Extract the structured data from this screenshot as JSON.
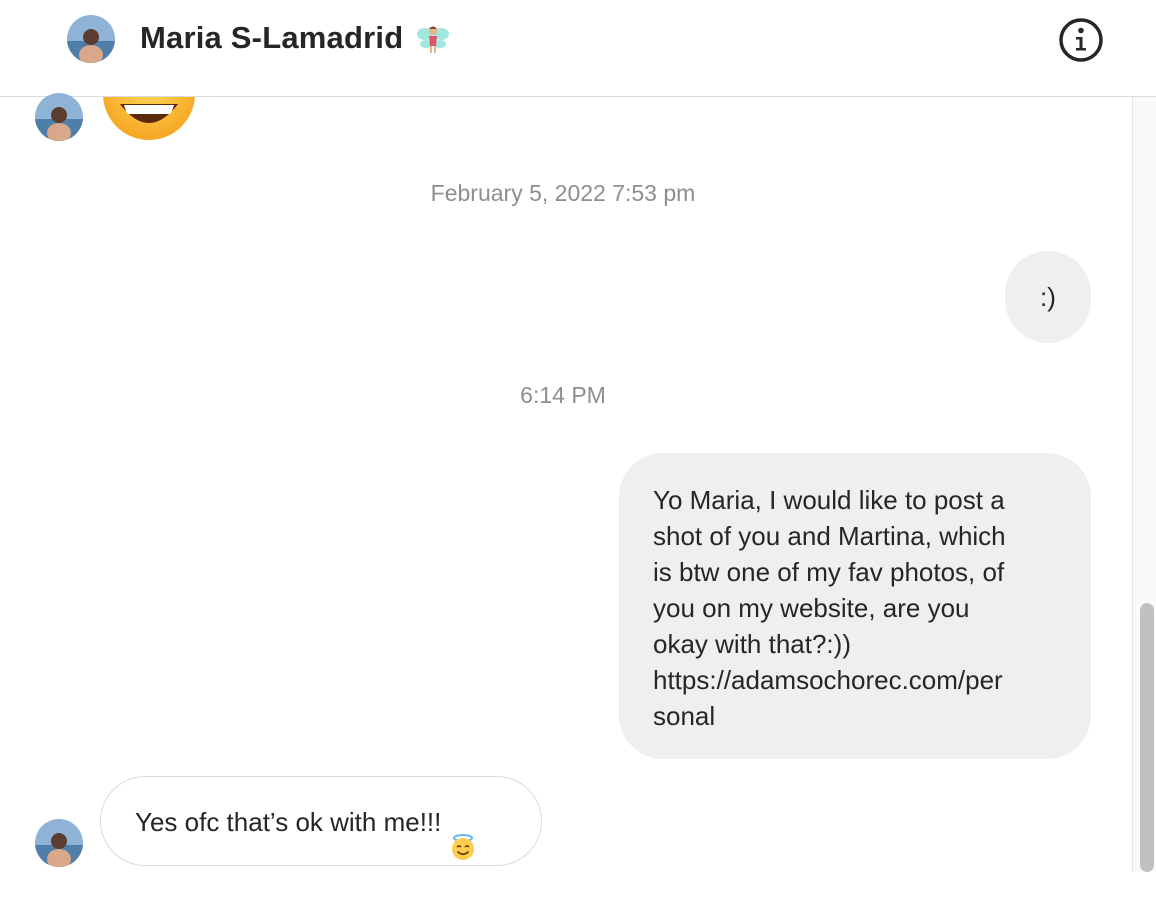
{
  "header": {
    "contact_name": "Maria S-Lamadrid",
    "name_emoji_icon": "fairy-emoji-icon",
    "info_icon": "info-icon"
  },
  "messages": {
    "heart_eyes_emoji": "heart-eyes-emoji-icon",
    "timestamp_1": "February 5, 2022 7:53 pm",
    "sent_smiley": ":)",
    "timestamp_2": "6:14 PM",
    "sent_long": "Yo Maria, I would like to post a\nshot of you and Martina, which\nis btw one of my fav photos, of\nyou on my website, are you\nokay with that?:))\nhttps://adamsochorec.com/per\nsonal",
    "received_reply": "Yes ofc that’s ok with me!!!",
    "reply_emoji": "smiling-face-with-halo-emoji-icon"
  },
  "colors": {
    "sent_bubble": "#efefef",
    "received_border": "#dbdbdb",
    "timestamp_text": "#8e8e8e",
    "text": "#262626"
  }
}
